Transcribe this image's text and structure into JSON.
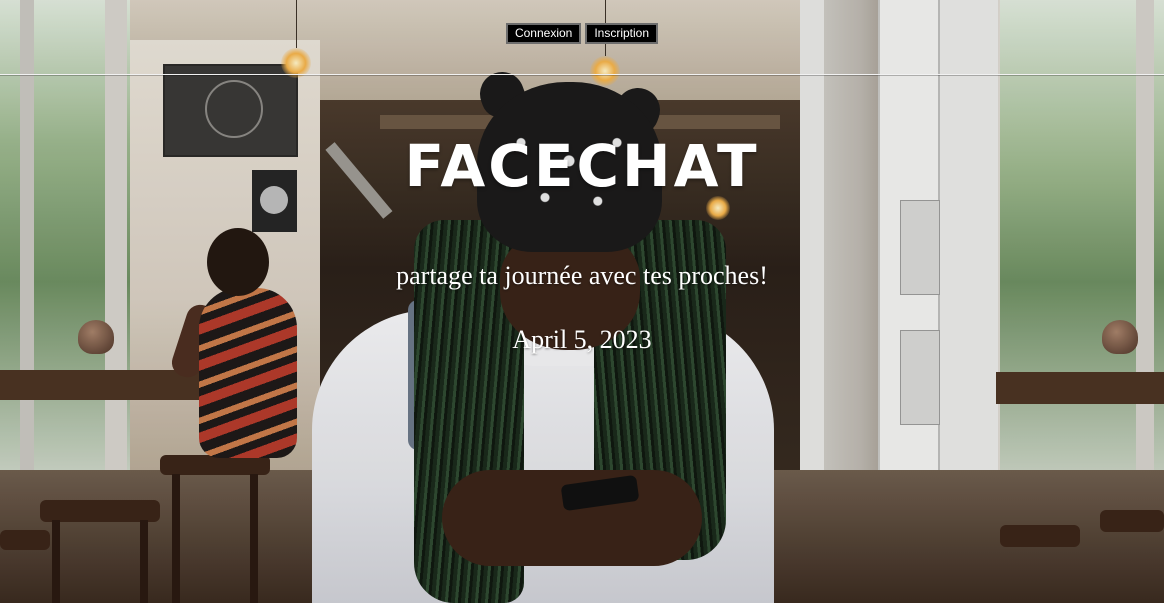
{
  "nav": {
    "login_label": "Connexion",
    "signup_label": "Inscription"
  },
  "hero": {
    "title": "FACECHAT",
    "tagline": "partage ta journée avec tes proches!",
    "date": "April 5, 2023"
  },
  "colors": {
    "button_bg": "#000000",
    "button_text": "#ffffff",
    "heading_text": "#ffffff",
    "divider": "#f2f2f2"
  }
}
